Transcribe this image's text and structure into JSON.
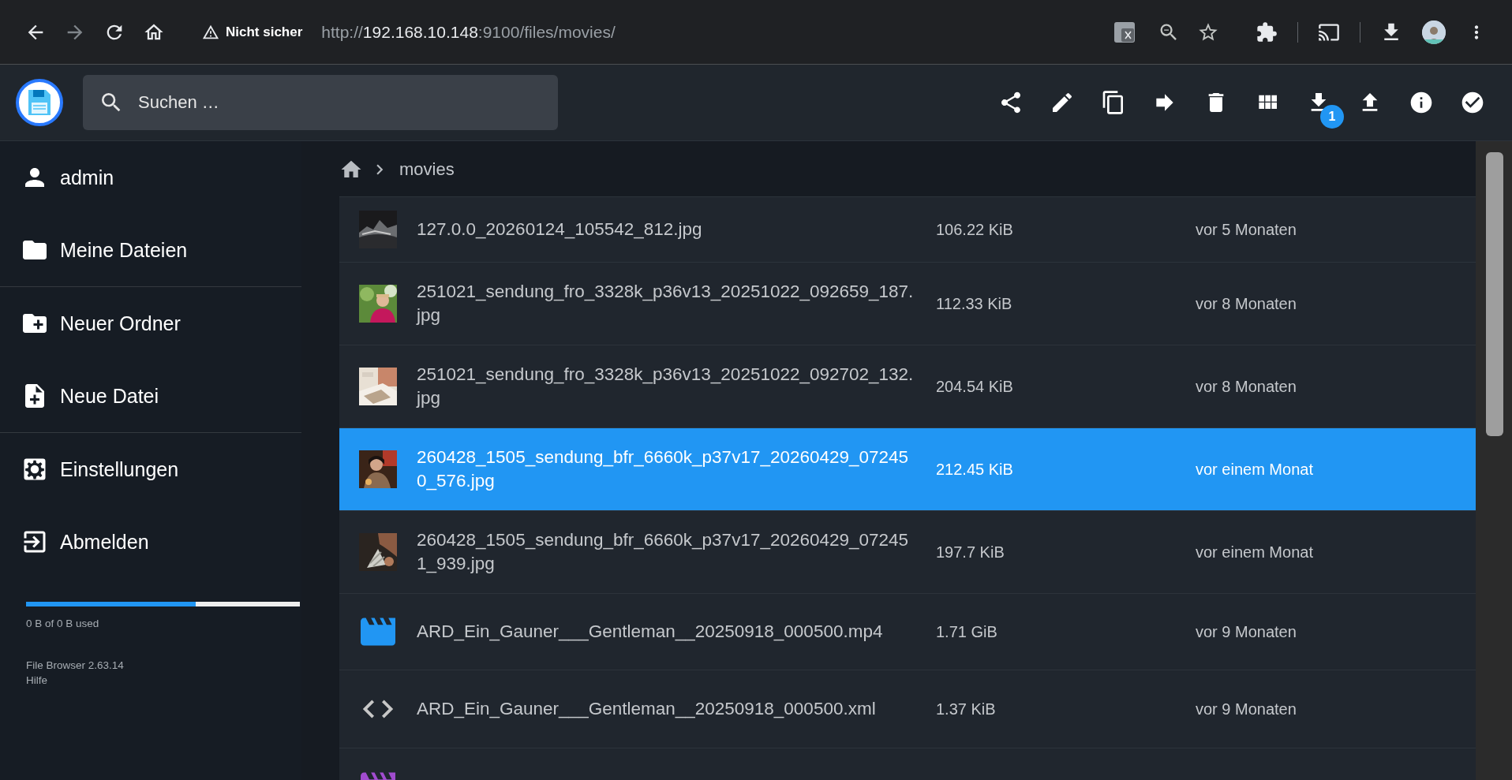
{
  "browser": {
    "security": "Nicht sicher",
    "url_scheme": "http://",
    "url_host": "192.168.10.148",
    "url_rest": ":9100/files/movies/"
  },
  "header": {
    "search_placeholder": "Suchen …",
    "download_badge": "1"
  },
  "sidebar": {
    "sections": [
      [
        {
          "label": "admin",
          "kind": "user"
        },
        {
          "label": "Meine Dateien",
          "kind": "folder"
        }
      ],
      [
        {
          "label": "Neuer Ordner",
          "kind": "new-folder"
        },
        {
          "label": "Neue Datei",
          "kind": "new-file"
        }
      ],
      [
        {
          "label": "Einstellungen",
          "kind": "settings"
        },
        {
          "label": "Abmelden",
          "kind": "logout"
        }
      ]
    ],
    "storage": {
      "level": 0.62,
      "text": "0 B of 0 B used"
    },
    "version": "File Browser 2.63.14",
    "help": "Hilfe"
  },
  "breadcrumb": [
    "movies"
  ],
  "files": [
    {
      "name": "127.0.0_20260124_105542_812.jpg",
      "size": "106.22 KiB",
      "modified": "vor 5 Monaten",
      "selected": false
    },
    {
      "name": "251021_sendung_fro_3328k_p36v13_20251022_092659_187.jpg",
      "size": "112.33 KiB",
      "modified": "vor 8 Monaten",
      "selected": false
    },
    {
      "name": "251021_sendung_fro_3328k_p36v13_20251022_092702_132.jpg",
      "size": "204.54 KiB",
      "modified": "vor 8 Monaten",
      "selected": false
    },
    {
      "name": "260428_1505_sendung_bfr_6660k_p37v17_20260429_072450_576.jpg",
      "size": "212.45 KiB",
      "modified": "vor einem Monat",
      "selected": true
    },
    {
      "name": "260428_1505_sendung_bfr_6660k_p37v17_20260429_072451_939.jpg",
      "size": "197.7 KiB",
      "modified": "vor einem Monat",
      "selected": false
    },
    {
      "kind": "video",
      "color": "#2196f3",
      "name": "ARD_Ein_Gauner___Gentleman__20250918_000500.mp4",
      "size": "1.71 GiB",
      "modified": "vor 9 Monaten",
      "selected": false
    },
    {
      "kind": "code",
      "name": "ARD_Ein_Gauner___Gentleman__20250918_000500.xml",
      "size": "1.37 KiB",
      "modified": "vor 9 Monaten",
      "selected": false
    },
    {
      "kind": "video",
      "color": "#a14ccf",
      "selected": false
    }
  ]
}
